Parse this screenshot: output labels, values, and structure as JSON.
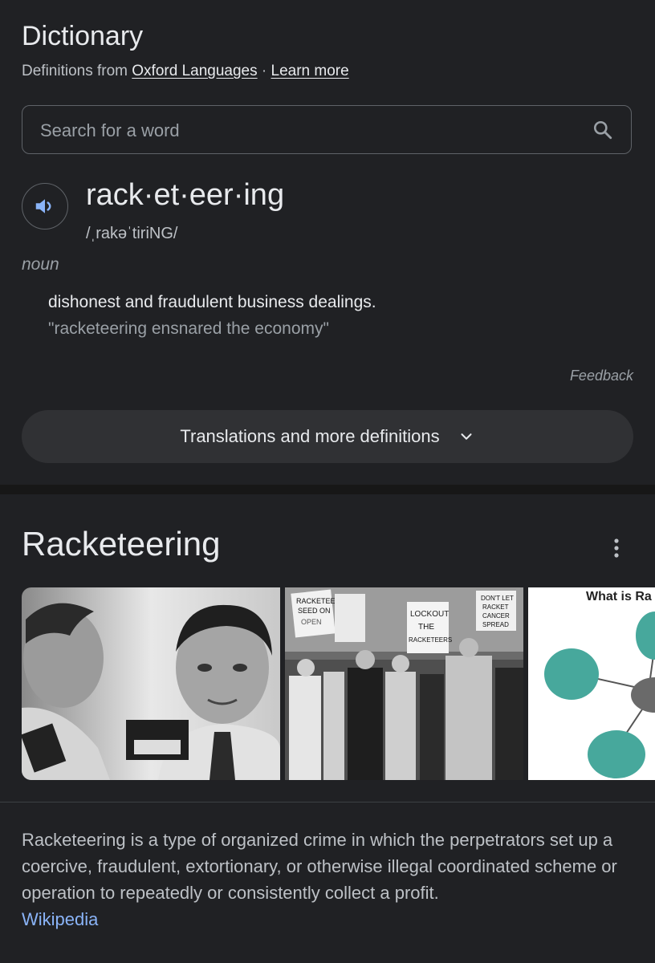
{
  "dictionary": {
    "title": "Dictionary",
    "source_prefix": "Definitions from ",
    "source_link": "Oxford Languages",
    "source_separator": " · ",
    "learn_more": "Learn more",
    "search_placeholder": "Search for a word",
    "word": "rack·et·eer·ing",
    "phonetic": "/ˌrakəˈtiriNG/",
    "part_of_speech": "noun",
    "definition": "dishonest and fraudulent business dealings.",
    "example": "\"racketeering ensnared the economy\"",
    "feedback": "Feedback",
    "more_button": "Translations and more definitions"
  },
  "knowledge_panel": {
    "title": "Racketeering",
    "images": [
      {
        "name": "mugshot-photo"
      },
      {
        "name": "picket-protest-photo",
        "signs": [
          "RACKETEERS SEED ON OPEN SHOPS",
          "LOCKOUT THE RACKETEERS",
          "DON'T LET RACKET CANCER SPREAD"
        ]
      },
      {
        "name": "diagram-thumbnail",
        "heading": "What is Ra"
      }
    ],
    "summary": "Racketeering is a type of organized crime in which the perpetrators set up a coercive, fraudulent, extortionary, or otherwise illegal coordinated scheme or operation to repeatedly or consistently collect a profit.",
    "source": "Wikipedia"
  },
  "colors": {
    "background": "#202124",
    "link_blue": "#8ab4f8",
    "audio_icon_blue": "#8ab4f8"
  }
}
